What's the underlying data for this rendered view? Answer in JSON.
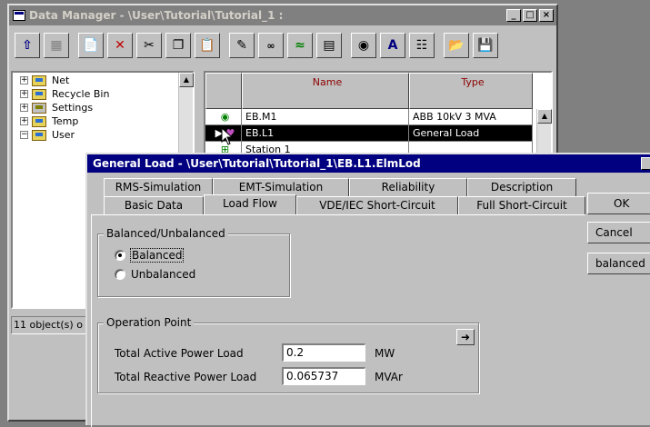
{
  "data_manager": {
    "title": "Data Manager - \\User\\Tutorial\\Tutorial_1 :",
    "window_buttons": [
      "_",
      "□",
      "×"
    ],
    "toolbar_icons": [
      "up-level-icon",
      "detail-view-icon",
      "new-object-icon",
      "delete-icon",
      "cut-icon",
      "copy-icon",
      "paste-icon",
      "edit-icon",
      "script-icon",
      "graph-icon",
      "data-icon",
      "binoculars-icon",
      "text-font-icon",
      "report-icon",
      "open-icon",
      "save-icon"
    ],
    "tree": [
      {
        "label": "Net",
        "expander": "+"
      },
      {
        "label": "Recycle Bin",
        "expander": "+"
      },
      {
        "label": "Settings",
        "expander": "+"
      },
      {
        "label": "Temp",
        "expander": "+"
      },
      {
        "label": "User",
        "expander": "−"
      }
    ],
    "grid": {
      "columns": [
        "Name",
        "Type"
      ],
      "rows": [
        {
          "name": "EB.M1",
          "type": "ABB 10kV 3 MVA",
          "icon": "motor-icon",
          "selected": false
        },
        {
          "name": "EB.L1",
          "type": "General Load",
          "icon": "load-icon",
          "selected": true
        },
        {
          "name": "Station 1",
          "type": "",
          "icon": "station-icon",
          "selected": false
        }
      ]
    },
    "status": "11 object(s) o"
  },
  "dialog": {
    "title": "General Load - \\User\\Tutorial\\Tutorial_1\\EB.L1.ElmLod",
    "tabs_back": [
      "RMS-Simulation",
      "EMT-Simulation",
      "Reliability",
      "Description"
    ],
    "tabs_front": [
      "Basic Data",
      "Load Flow",
      "VDE/IEC Short-Circuit",
      "Full Short-Circuit"
    ],
    "active_tab": "Load Flow",
    "balanced_group": {
      "title": "Balanced/Unbalanced",
      "options": [
        "Balanced",
        "Unbalanced"
      ],
      "selected": "Balanced"
    },
    "operation_group": {
      "title": "Operation Point",
      "active_power_label": "Total Active Power Load",
      "active_power_value": "0.2",
      "active_power_unit": "MW",
      "reactive_power_label": "Total Reactive Power Load",
      "reactive_power_value": "0.065737",
      "reactive_power_unit": "MVAr",
      "arrow": "➜"
    },
    "buttons": [
      "OK",
      "Cancel",
      "balanced"
    ]
  }
}
